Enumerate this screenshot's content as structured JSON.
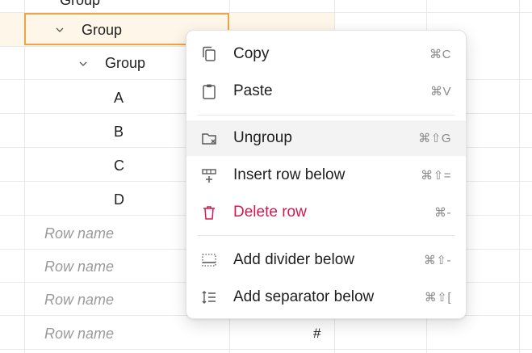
{
  "grid": {
    "top_partial": "Group",
    "group_level1": "Group",
    "group_level2": "Group",
    "rows": [
      "A",
      "B",
      "C",
      "D"
    ],
    "placeholders": [
      "Row name",
      "Row name",
      "Row name",
      "Row name"
    ],
    "hash_symbol": "#"
  },
  "menu": {
    "items": [
      {
        "label": "Copy",
        "shortcut": "⌘C",
        "icon": "copy-icon"
      },
      {
        "label": "Paste",
        "shortcut": "⌘V",
        "icon": "clipboard-icon"
      },
      {
        "label": "Ungroup",
        "shortcut": "⌘⇧G",
        "icon": "ungroup-folder-icon"
      },
      {
        "label": "Insert row below",
        "shortcut": "⌘⇧=",
        "icon": "insert-row-icon"
      },
      {
        "label": "Delete row",
        "shortcut": "⌘-",
        "icon": "trash-icon"
      },
      {
        "label": "Add divider below",
        "shortcut": "⌘⇧-",
        "icon": "divider-icon"
      },
      {
        "label": "Add separator below",
        "shortcut": "⌘⇧[",
        "icon": "separator-icon"
      }
    ],
    "colors": {
      "danger": "#d0194f",
      "selection_border": "#f0a544",
      "selection_bg": "#fff6ea"
    }
  }
}
